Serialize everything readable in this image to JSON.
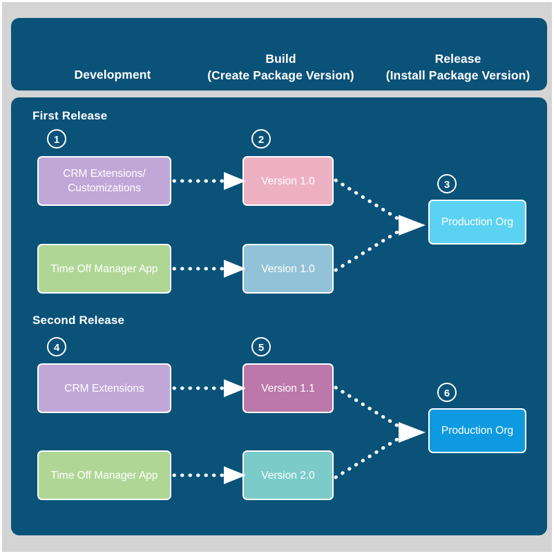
{
  "colors": {
    "page_background": "#d4d4d4",
    "panel_background": "#0b5279",
    "outline": "#ffffff"
  },
  "header": {
    "columns": [
      {
        "id": "development",
        "line1": "Development",
        "line2": ""
      },
      {
        "id": "build",
        "line1": "Build",
        "line2": "(Create Package Version)"
      },
      {
        "id": "release",
        "line1": "Release",
        "line2": "(Install Package Version)"
      }
    ]
  },
  "sections": [
    {
      "id": "first-release",
      "title": "First Release",
      "badges": [
        {
          "number": "1"
        },
        {
          "number": "2"
        },
        {
          "number": "3"
        }
      ],
      "nodes": [
        {
          "id": "crm-extensions-customizations",
          "label": "CRM Extensions/\nCustomizations",
          "color": "#c1a6d8"
        },
        {
          "id": "time-off-manager-app-1",
          "label": "Time Off Manager App",
          "color": "#afd694"
        },
        {
          "id": "version-1-0-crm",
          "label": "Version 1.0",
          "color": "#eeb1c3"
        },
        {
          "id": "version-1-0-app",
          "label": "Version 1.0",
          "color": "#92c2d7"
        },
        {
          "id": "production-org-1",
          "label": "Production Org",
          "color": "#5bd2f1"
        }
      ]
    },
    {
      "id": "second-release",
      "title": "Second Release",
      "badges": [
        {
          "number": "4"
        },
        {
          "number": "5"
        },
        {
          "number": "6"
        }
      ],
      "nodes": [
        {
          "id": "crm-extensions",
          "label": "CRM Extensions",
          "color": "#c1a6d8"
        },
        {
          "id": "time-off-manager-app-2",
          "label": "Time Off Manager App",
          "color": "#afd694"
        },
        {
          "id": "version-1-1",
          "label": "Version 1.1",
          "color": "#bc77ab"
        },
        {
          "id": "version-2-0",
          "label": "Version 2.0",
          "color": "#7bccc9"
        },
        {
          "id": "production-org-2",
          "label": "Production Org",
          "color": "#0d9ae0"
        }
      ]
    }
  ]
}
